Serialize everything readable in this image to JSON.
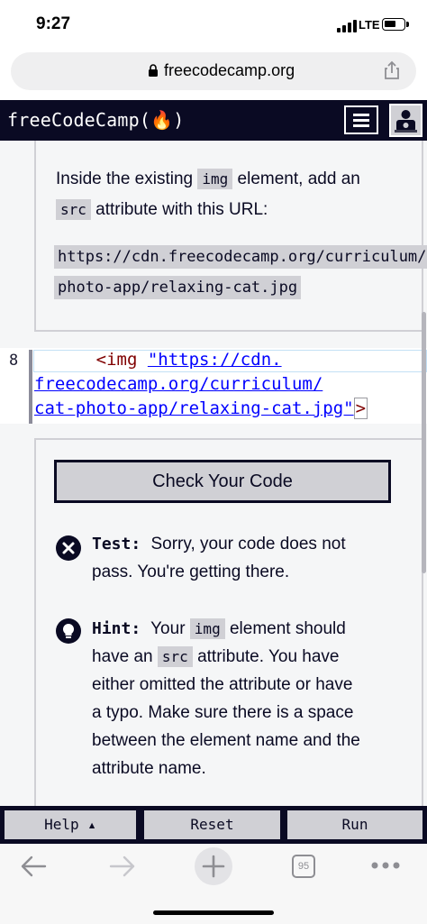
{
  "status": {
    "time": "9:27",
    "network": "LTE"
  },
  "browser": {
    "domain": "freecodecamp.org",
    "tab_count": "95"
  },
  "nav": {
    "brand": "freeCodeCamp(🔥)"
  },
  "instructions": {
    "line1_before": "Inside the existing ",
    "line1_code": "img",
    "line1_after": " element, add an",
    "line2_code": "src",
    "line2_after": " attribute with this URL:",
    "url_line1": "https://cdn.freecodecamp.org/curriculum/cat-",
    "url_line2": "photo-app/relaxing-cat.jpg"
  },
  "editor": {
    "line_number": "8",
    "line1_indent": "      ",
    "tag_open": "<img",
    "string_part1": "\"https://cdn.",
    "string_part2": "freecodecamp.org/curriculum/",
    "string_part3": "cat-photo-app/relaxing-cat.jpg\"",
    "tag_close": ">"
  },
  "feedback": {
    "check_button": "Check Your Code",
    "test_label": "Test:",
    "test_text_line1": "Sorry, your code does not",
    "test_text_line2": "pass. You're getting there.",
    "hint_label": "Hint:",
    "hint_before": "Your ",
    "hint_code1": "img",
    "hint_mid1": " element should",
    "hint_line2_before": "have an ",
    "hint_code2": "src",
    "hint_line2_after": " attribute. You have",
    "hint_line3": "either omitted the attribute or have",
    "hint_line4": "a typo. Make sure there is a space",
    "hint_line5": "between the element name and the",
    "hint_line6": "attribute name."
  },
  "actions": {
    "help": "Help ▴",
    "reset": "Reset",
    "run": "Run"
  },
  "colors": {
    "fcc_dark": "#0a0a23",
    "fcc_gray": "#d0d0d5",
    "panel_bg": "#f5f6f7"
  }
}
